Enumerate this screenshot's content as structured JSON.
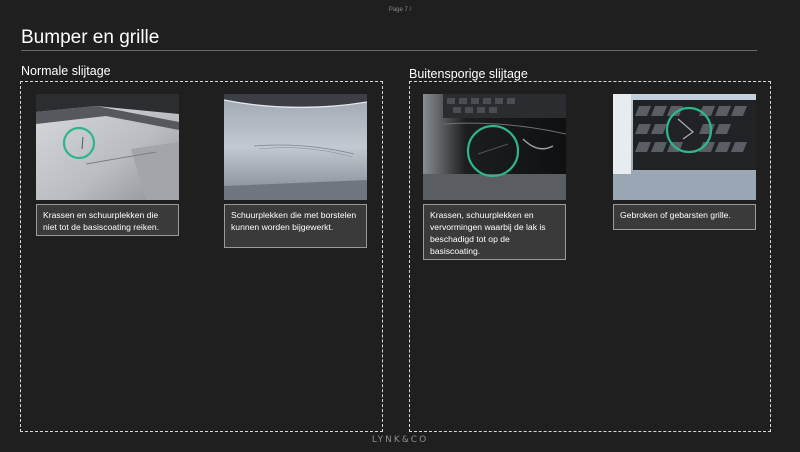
{
  "page": {
    "label": "Page 7 /"
  },
  "title": "Bumper en grille",
  "sections": [
    {
      "heading": "Normale slijtage",
      "items": [
        {
          "image": "bumper-scratch-photo",
          "caption": "Krassen en schuurplekken die niet tot de basiscoating reiken."
        },
        {
          "image": "bumper-scuff-photo",
          "caption": "Schuurplekken die met borstelen kunnen worden bijgewerkt."
        }
      ]
    },
    {
      "heading": "Buitensporige slijtage",
      "items": [
        {
          "image": "bumper-deep-damage-photo",
          "caption": "Krassen, schuurplekken en vervormingen waarbij de lak is beschadigd tot op de basiscoating."
        },
        {
          "image": "broken-grille-photo",
          "caption": "Gebroken of gebarsten grille."
        }
      ]
    }
  ],
  "footer": {
    "logo": "LYNK&CO"
  },
  "colors": {
    "background": "#1f1f1f",
    "highlight_circle": "#2fb58a",
    "caption_bg": "#3a3a3a"
  }
}
